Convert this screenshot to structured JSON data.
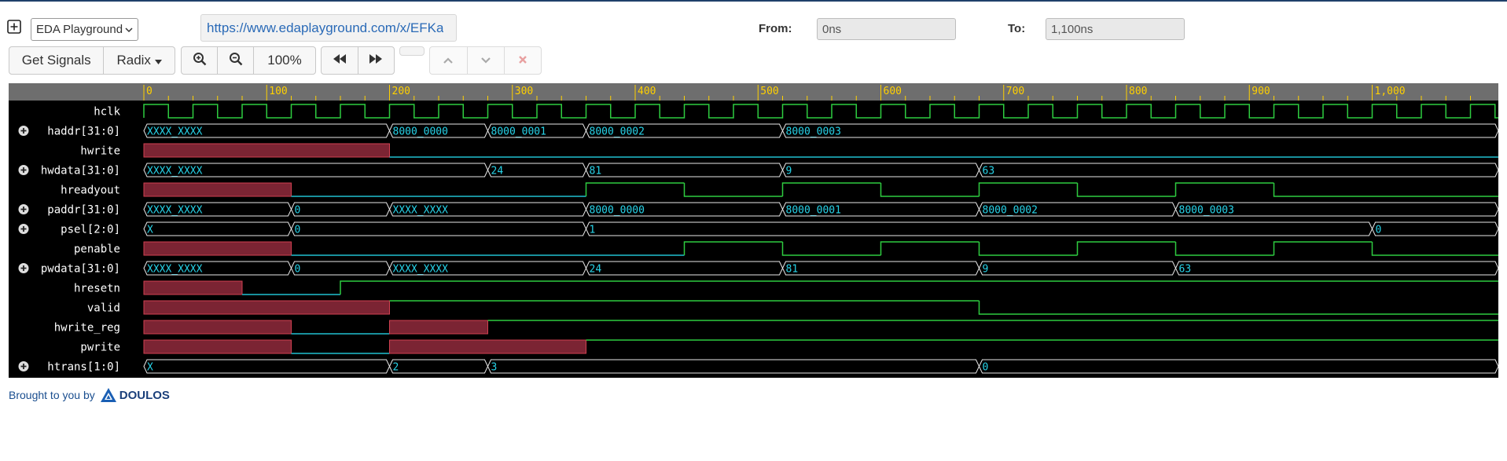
{
  "toolbar": {
    "add_icon": "plus-square-icon",
    "playground_select": "EDA Playground",
    "url": "https://www.edaplayground.com/x/EFKa",
    "from_label": "From:",
    "from_value": "0ns",
    "to_label": "To:",
    "to_value": "1,100ns",
    "get_signals": "Get Signals",
    "radix": "Radix",
    "zoom_level": "100%"
  },
  "timeline": {
    "ticks": [
      "0",
      "100",
      "200",
      "300",
      "400",
      "500",
      "600",
      "700",
      "800",
      "900",
      "1,000"
    ],
    "range_ns": [
      0,
      1100
    ]
  },
  "signals": [
    {
      "name": "hclk",
      "expandable": false,
      "type": "clock",
      "period": 40
    },
    {
      "name": "haddr[31:0]",
      "expandable": true,
      "type": "bus",
      "segments": [
        {
          "t": 0,
          "v": "XXXX_XXXX"
        },
        {
          "t": 200,
          "v": "8000_0000"
        },
        {
          "t": 280,
          "v": "8000_0001"
        },
        {
          "t": 360,
          "v": "8000_0002"
        },
        {
          "t": 520,
          "v": "8000_0003"
        }
      ]
    },
    {
      "name": "hwrite",
      "expandable": false,
      "type": "bit",
      "segments": [
        {
          "t": 0,
          "v": "x"
        },
        {
          "t": 200,
          "v": "0"
        }
      ]
    },
    {
      "name": "hwdata[31:0]",
      "expandable": true,
      "type": "bus",
      "segments": [
        {
          "t": 0,
          "v": "XXXX_XXXX"
        },
        {
          "t": 280,
          "v": "24"
        },
        {
          "t": 360,
          "v": "81"
        },
        {
          "t": 520,
          "v": "9"
        },
        {
          "t": 680,
          "v": "63"
        }
      ]
    },
    {
      "name": "hreadyout",
      "expandable": false,
      "type": "bit",
      "segments": [
        {
          "t": 0,
          "v": "x"
        },
        {
          "t": 120,
          "v": "0"
        },
        {
          "t": 360,
          "v": "1"
        },
        {
          "t": 440,
          "v": "0"
        },
        {
          "t": 520,
          "v": "1"
        },
        {
          "t": 600,
          "v": "0"
        },
        {
          "t": 680,
          "v": "1"
        },
        {
          "t": 760,
          "v": "0"
        },
        {
          "t": 840,
          "v": "1"
        },
        {
          "t": 920,
          "v": "0"
        }
      ]
    },
    {
      "name": "paddr[31:0]",
      "expandable": true,
      "type": "bus",
      "segments": [
        {
          "t": 0,
          "v": "XXXX_XXXX"
        },
        {
          "t": 120,
          "v": "0"
        },
        {
          "t": 200,
          "v": "XXXX_XXXX"
        },
        {
          "t": 360,
          "v": "8000_0000"
        },
        {
          "t": 520,
          "v": "8000_0001"
        },
        {
          "t": 680,
          "v": "8000_0002"
        },
        {
          "t": 840,
          "v": "8000_0003"
        }
      ]
    },
    {
      "name": "psel[2:0]",
      "expandable": true,
      "type": "bus",
      "segments": [
        {
          "t": 0,
          "v": "X"
        },
        {
          "t": 120,
          "v": "0"
        },
        {
          "t": 360,
          "v": "1"
        },
        {
          "t": 1000,
          "v": "0"
        }
      ]
    },
    {
      "name": "penable",
      "expandable": false,
      "type": "bit",
      "segments": [
        {
          "t": 0,
          "v": "x"
        },
        {
          "t": 120,
          "v": "0"
        },
        {
          "t": 440,
          "v": "1"
        },
        {
          "t": 520,
          "v": "0"
        },
        {
          "t": 600,
          "v": "1"
        },
        {
          "t": 680,
          "v": "0"
        },
        {
          "t": 760,
          "v": "1"
        },
        {
          "t": 840,
          "v": "0"
        },
        {
          "t": 920,
          "v": "1"
        },
        {
          "t": 1000,
          "v": "0"
        }
      ]
    },
    {
      "name": "pwdata[31:0]",
      "expandable": true,
      "type": "bus",
      "segments": [
        {
          "t": 0,
          "v": "XXXX_XXXX"
        },
        {
          "t": 120,
          "v": "0"
        },
        {
          "t": 200,
          "v": "XXXX_XXXX"
        },
        {
          "t": 360,
          "v": "24"
        },
        {
          "t": 520,
          "v": "81"
        },
        {
          "t": 680,
          "v": "9"
        },
        {
          "t": 840,
          "v": "63"
        }
      ]
    },
    {
      "name": "hresetn",
      "expandable": false,
      "type": "bit",
      "segments": [
        {
          "t": 0,
          "v": "x"
        },
        {
          "t": 80,
          "v": "0"
        },
        {
          "t": 160,
          "v": "1"
        }
      ]
    },
    {
      "name": "valid",
      "expandable": false,
      "type": "bit",
      "segments": [
        {
          "t": 0,
          "v": "x"
        },
        {
          "t": 200,
          "v": "1"
        },
        {
          "t": 680,
          "v": "0"
        }
      ]
    },
    {
      "name": "hwrite_reg",
      "expandable": false,
      "type": "bit",
      "segments": [
        {
          "t": 0,
          "v": "x"
        },
        {
          "t": 120,
          "v": "0"
        },
        {
          "t": 200,
          "v": "x"
        },
        {
          "t": 280,
          "v": "1"
        }
      ]
    },
    {
      "name": "pwrite",
      "expandable": false,
      "type": "bit",
      "segments": [
        {
          "t": 0,
          "v": "x"
        },
        {
          "t": 120,
          "v": "0"
        },
        {
          "t": 200,
          "v": "x"
        },
        {
          "t": 360,
          "v": "1"
        }
      ]
    },
    {
      "name": "htrans[1:0]",
      "expandable": true,
      "type": "bus",
      "segments": [
        {
          "t": 0,
          "v": "X"
        },
        {
          "t": 200,
          "v": "2"
        },
        {
          "t": 280,
          "v": "3"
        },
        {
          "t": 680,
          "v": "0"
        }
      ]
    }
  ],
  "footer": {
    "text": "Brought to you by",
    "brand": "DOULOS"
  },
  "colors": {
    "bg": "#000000",
    "header": "#6e6e6e",
    "tick": "#ffd000",
    "wave": "#2ecc40",
    "bus_text": "#27d3e8",
    "xfill": "#7b2433",
    "xstroke": "#d04050",
    "name": "#ffffff"
  }
}
